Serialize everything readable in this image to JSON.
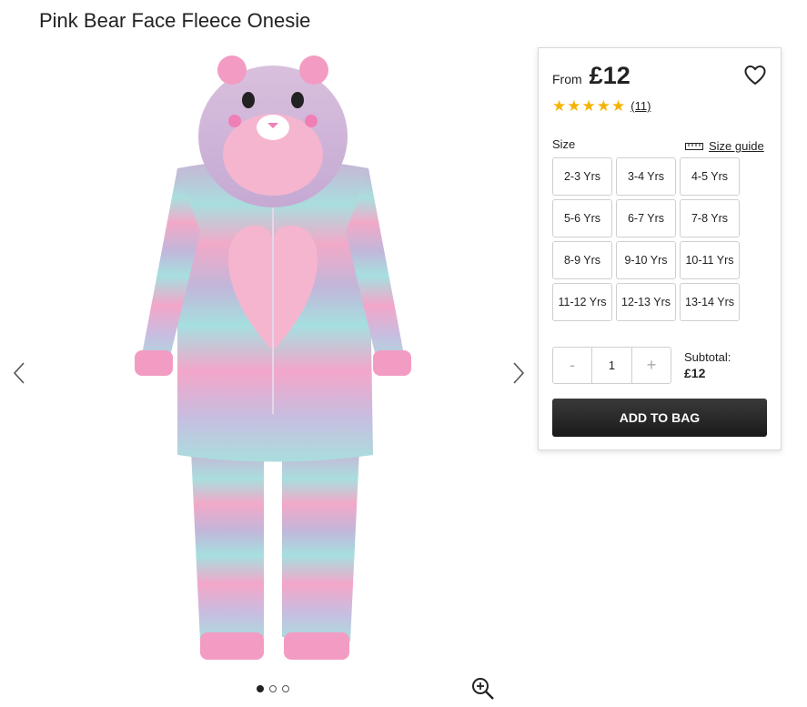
{
  "product": {
    "title": "Pink Bear Face Fleece Onesie"
  },
  "gallery": {
    "prev_icon": "chevron-left-icon",
    "next_icon": "chevron-right-icon",
    "image_description": "pastel tie-dye bear onesie",
    "dots": [
      true,
      false,
      false
    ],
    "zoom_icon": "zoom-in-icon"
  },
  "purchase": {
    "price_prefix": "From",
    "price": "£12",
    "wishlist_icon": "heart-icon",
    "rating": {
      "stars": 5,
      "reviews": "(11)"
    },
    "size_label": "Size",
    "size_guide": "Size guide",
    "sizes": [
      "2-3 Yrs",
      "3-4 Yrs",
      "4-5 Yrs",
      "5-6 Yrs",
      "6-7 Yrs",
      "7-8 Yrs",
      "8-9 Yrs",
      "9-10 Yrs",
      "10-11 Yrs",
      "11-12 Yrs",
      "12-13 Yrs",
      "13-14 Yrs"
    ],
    "quantity": {
      "minus": "-",
      "value": "1",
      "plus": "+"
    },
    "subtotal_label": "Subtotal:",
    "subtotal_value": "£12",
    "add_to_bag": "ADD TO BAG"
  },
  "colors": {
    "star": "#f5b301",
    "button": "#222222"
  }
}
